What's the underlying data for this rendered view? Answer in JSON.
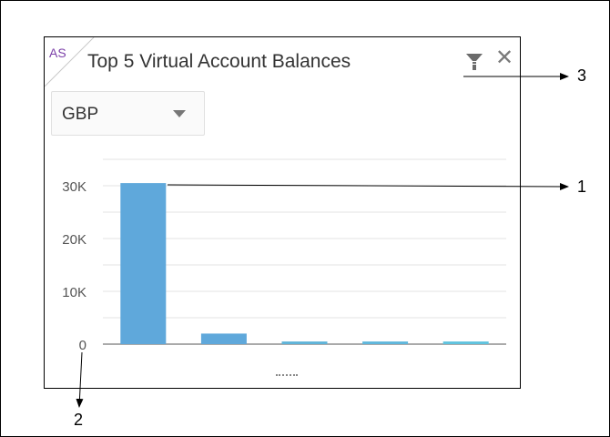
{
  "widget": {
    "corner_initials": "AS",
    "title": "Top 5 Virtual Account Balances",
    "currency": {
      "selected": "GBP"
    },
    "filter_icon": "filter-icon",
    "close_icon": "close-icon",
    "close_glyph": "✕"
  },
  "chart_data": {
    "type": "bar",
    "title": "",
    "xlabel": "",
    "ylabel": "",
    "categories": [
      "",
      "",
      "",
      "",
      ""
    ],
    "values": [
      30500,
      2000,
      500,
      500,
      500
    ],
    "ylim": [
      0,
      35000
    ],
    "y_ticks": [
      0,
      10000,
      20000,
      30000
    ],
    "y_tick_labels": [
      "0",
      "10K",
      "20K",
      "30K"
    ],
    "grid": true,
    "bar_colors": [
      "#5fa8db",
      "#5fa8db",
      "#5fb4d9",
      "#5fb7dc",
      "#5fc3de"
    ]
  },
  "callouts": [
    "1",
    "2",
    "3"
  ],
  "colors": {
    "accent": "#7b3fa8",
    "grid": "#e3e3e3",
    "axis": "#555555"
  }
}
